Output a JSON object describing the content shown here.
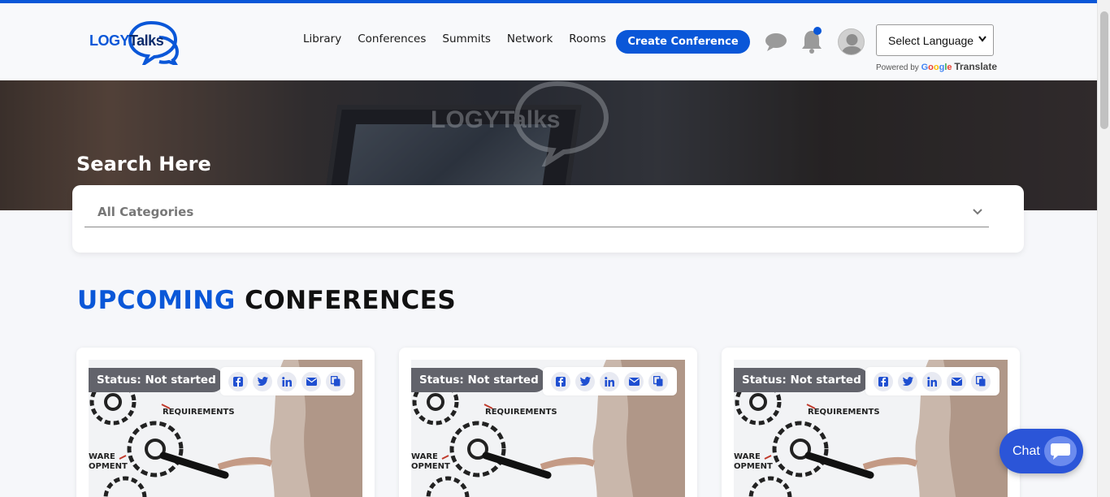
{
  "header": {
    "logo": {
      "part1": "LOGY",
      "part2": "Talks"
    },
    "nav": [
      {
        "label": "Library"
      },
      {
        "label": "Conferences"
      },
      {
        "label": "Summits"
      },
      {
        "label": "Network"
      },
      {
        "label": "Rooms"
      }
    ],
    "create_button": "Create Conference",
    "language_select": {
      "value": "Select Language"
    },
    "powered_by": {
      "prefix": "Powered by",
      "google_1": "G",
      "google_2": "o",
      "google_3": "o",
      "google_4": "g",
      "google_5": "l",
      "google_6": "e",
      "translate": "Translate"
    }
  },
  "hero": {
    "watermark": "LOGYTalks",
    "search_title": "Search Here"
  },
  "search": {
    "category_value": "All Categories"
  },
  "section": {
    "title_highlight": "UPCOMING",
    "title_rest": "CONFERENCES"
  },
  "cards": [
    {
      "status": "Status: Not started",
      "img_text_1": "REQUIREMENTS",
      "img_text_2": "WARE",
      "img_text_3": "OPMENT"
    },
    {
      "status": "Status: Not started",
      "img_text_1": "REQUIREMENTS",
      "img_text_2": "WARE",
      "img_text_3": "OPMENT"
    },
    {
      "status": "Status: Not started",
      "img_text_1": "REQUIREMENTS",
      "img_text_2": "WARE",
      "img_text_3": "OPMENT"
    }
  ],
  "share_icons": [
    "facebook-icon",
    "twitter-icon",
    "linkedin-icon",
    "email-icon",
    "copy-icon"
  ],
  "chat_widget": {
    "label": "Chat"
  },
  "colors": {
    "brand_blue": "#0a57d8",
    "status_gray": "#62636b",
    "chat_blue": "#2b55d8"
  }
}
